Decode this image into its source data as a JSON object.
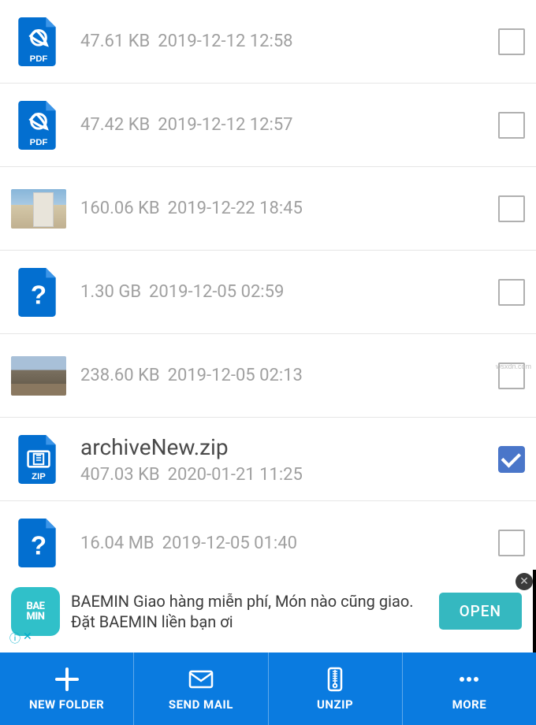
{
  "files": [
    {
      "icon": "pdf",
      "name": "",
      "size": "47.61 KB",
      "date": "2019-12-12 12:58",
      "checked": false
    },
    {
      "icon": "pdf",
      "name": "",
      "size": "47.42 KB",
      "date": "2019-12-12 12:57",
      "checked": false
    },
    {
      "icon": "image-building",
      "name": "",
      "size": "160.06 KB",
      "date": "2019-12-22 18:45",
      "checked": false
    },
    {
      "icon": "unknown",
      "name": "",
      "size": "1.30 GB",
      "date": "2019-12-05 02:59",
      "checked": false
    },
    {
      "icon": "image-street",
      "name": "",
      "size": "238.60 KB",
      "date": "2019-12-05 02:13",
      "checked": false
    },
    {
      "icon": "zip",
      "name": "archiveNew.zip",
      "size": "407.03 KB",
      "date": "2020-01-21 11:25",
      "checked": true
    },
    {
      "icon": "unknown",
      "name": "",
      "size": "16.04 MB",
      "date": "2019-12-05 01:40",
      "checked": false
    }
  ],
  "ad": {
    "brand": "BAE\nMIN",
    "text": "BAEMIN Giao hàng miễn phí, Món nào cũng giao. Đặt BAEMIN liền bạn ơi",
    "cta": "OPEN"
  },
  "toolbar": {
    "new_folder": "NEW FOLDER",
    "send_mail": "SEND MAIL",
    "unzip": "UNZIP",
    "more": "MORE"
  },
  "watermark": "wsxdn.com",
  "colors": {
    "primary": "#0a7be0",
    "icon_blue": "#036fd0",
    "check": "#4a76c9",
    "ad_accent": "#35b8c0"
  }
}
